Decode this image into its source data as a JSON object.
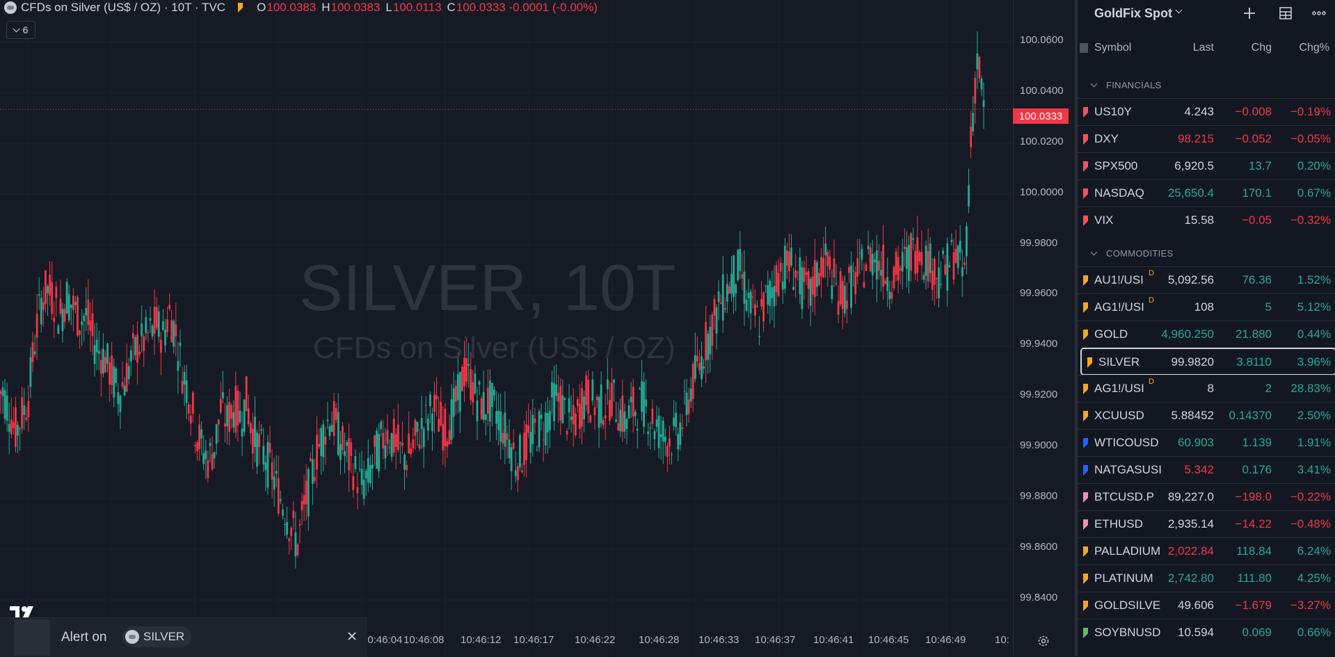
{
  "header": {
    "title": "CFDs on Silver (US$ / OZ) · 10T · TVC",
    "o_label": "O",
    "o_value": "100.0383",
    "h_label": "H",
    "h_value": "100.0383",
    "l_label": "L",
    "l_value": "100.0113",
    "c_label": "C",
    "c_value": "100.0333 -0.0001 (-0.00%)",
    "indicator_count": "6"
  },
  "watermark": {
    "line1": "SILVER, 10T",
    "line2": "CFDs on Silver (US$ / OZ)"
  },
  "price_scale": {
    "ticks": [
      "100.0600",
      "100.0400",
      "100.0200",
      "100.0000",
      "99.9800",
      "99.9600",
      "99.9400",
      "99.9200",
      "99.9000",
      "99.8800",
      "99.8600",
      "99.8400"
    ],
    "last_price": "100.0333"
  },
  "time_axis": {
    "ticks": [
      "10:46:04",
      "10:46:08",
      "10:46:12",
      "10:46:17",
      "10:46:22",
      "10:46:28",
      "10:46:33",
      "10:46:37",
      "10:46:41",
      "10:46:45",
      "10:46:49",
      "10:"
    ]
  },
  "chart_data": {
    "type": "candlestick",
    "symbol": "SILVER",
    "interval": "10T",
    "ylim": [
      99.83,
      100.07
    ],
    "last": 100.0333,
    "colors": {
      "up": "#22ab94",
      "down": "#f23645"
    },
    "closes": [
      99.922,
      99.915,
      99.906,
      99.912,
      99.92,
      99.942,
      99.958,
      99.962,
      99.958,
      99.952,
      99.96,
      99.955,
      99.95,
      99.952,
      99.943,
      99.938,
      99.935,
      99.928,
      99.922,
      99.926,
      99.934,
      99.94,
      99.942,
      99.945,
      99.948,
      99.944,
      99.953,
      99.945,
      99.93,
      99.922,
      99.908,
      99.9,
      99.895,
      99.9,
      99.915,
      99.91,
      99.916,
      99.912,
      99.918,
      99.906,
      99.9,
      99.896,
      99.89,
      99.882,
      99.876,
      99.868,
      99.862,
      99.876,
      99.886,
      99.898,
      99.906,
      99.912,
      99.908,
      99.9,
      99.895,
      99.89,
      99.885,
      99.888,
      99.896,
      99.902,
      99.906,
      99.902,
      99.898,
      99.896,
      99.9,
      99.906,
      99.91,
      99.916,
      99.911,
      99.906,
      99.912,
      99.92,
      99.93,
      99.926,
      99.92,
      99.916,
      99.918,
      99.914,
      99.908,
      99.903,
      99.895,
      99.897,
      99.902,
      99.906,
      99.908,
      99.912,
      99.92,
      99.918,
      99.912,
      99.908,
      99.915,
      99.92,
      99.918,
      99.916,
      99.917,
      99.92,
      99.915,
      99.91,
      99.914,
      99.916,
      99.918,
      99.912,
      99.908,
      99.905,
      99.903,
      99.905,
      99.91,
      99.92,
      99.928,
      99.935,
      99.944,
      99.95,
      99.958,
      99.962,
      99.968,
      99.97,
      99.96,
      99.952,
      99.95,
      99.958,
      99.962,
      99.968,
      99.972,
      99.972,
      99.968,
      99.962,
      99.96,
      99.968,
      99.974,
      99.97,
      99.962,
      99.96,
      99.963,
      99.966,
      99.97,
      99.974,
      99.976,
      99.972,
      99.968,
      99.967,
      99.97,
      99.974,
      99.977,
      99.978,
      99.975,
      99.971,
      99.968,
      99.97,
      99.975,
      99.975,
      99.968,
      100.02,
      100.055,
      100.0333
    ],
    "highs_note": "wick ranges estimated from picture"
  },
  "alert": {
    "prefix": "Alert on",
    "symbol": "SILVER"
  },
  "watchlist": {
    "title": "GoldFix Spot",
    "columns": {
      "symbol": "Symbol",
      "last": "Last",
      "chg": "Chg",
      "chgp": "Chg%"
    },
    "sections": [
      {
        "name": "FINANCIALS",
        "rows": [
          {
            "sym": "US10Y",
            "last": "4.243",
            "chg": "−0.008",
            "pct": "−0.19%",
            "flag": "#f7525f",
            "lastc": "wht",
            "chgc": "neg"
          },
          {
            "sym": "DXY",
            "last": "98.215",
            "chg": "−0.052",
            "pct": "−0.05%",
            "flag": "#f7525f",
            "lastc": "neg",
            "chgc": "neg"
          },
          {
            "sym": "SPX500",
            "last": "6,920.5",
            "chg": "13.7",
            "pct": "0.20%",
            "flag": "#f7525f",
            "lastc": "wht",
            "chgc": "pos"
          },
          {
            "sym": "NASDAQ",
            "last": "25,650.4",
            "chg": "170.1",
            "pct": "0.67%",
            "flag": "#f7525f",
            "lastc": "pos",
            "chgc": "pos"
          },
          {
            "sym": "VIX",
            "last": "15.58",
            "chg": "−0.05",
            "pct": "−0.32%",
            "flag": "#f7525f",
            "lastc": "wht",
            "chgc": "neg"
          }
        ]
      },
      {
        "name": "COMMODITIES",
        "rows": [
          {
            "sym": "AU1!/USI",
            "d": "D",
            "last": "5,092.56",
            "chg": "76.36",
            "pct": "1.52%",
            "flag": "#f6a821",
            "lastc": "wht",
            "chgc": "pos"
          },
          {
            "sym": "AG1!/USI",
            "d": "D",
            "last": "108",
            "chg": "5",
            "pct": "5.12%",
            "flag": "#f6a821",
            "lastc": "wht",
            "chgc": "pos"
          },
          {
            "sym": "GOLD",
            "last": "4,960.250",
            "chg": "21.880",
            "pct": "0.44%",
            "flag": "#f6a821",
            "lastc": "pos",
            "chgc": "pos"
          },
          {
            "sym": "SILVER",
            "last": "99.9820",
            "chg": "3.8110",
            "pct": "3.96%",
            "flag": "#f6a821",
            "lastc": "wht",
            "chgc": "pos",
            "selected": true
          },
          {
            "sym": "AG1!/USI",
            "d": "D",
            "last": "8",
            "chg": "2",
            "pct": "28.83%",
            "flag": "#f6a821",
            "lastc": "wht",
            "chgc": "pos"
          },
          {
            "sym": "XCUUSD",
            "last": "5.88452",
            "chg": "0.14370",
            "pct": "2.50%",
            "flag": "#f6a821",
            "lastc": "wht",
            "chgc": "pos"
          },
          {
            "sym": "WTICOUSD",
            "last": "60.903",
            "chg": "1.139",
            "pct": "1.91%",
            "flag": "#2962ff",
            "lastc": "pos",
            "chgc": "pos"
          },
          {
            "sym": "NATGASUSI",
            "last": "5.342",
            "chg": "0.176",
            "pct": "3.41%",
            "flag": "#2962ff",
            "lastc": "neg",
            "chgc": "pos"
          },
          {
            "sym": "BTCUSD.P",
            "last": "89,227.0",
            "chg": "−198.0",
            "pct": "−0.22%",
            "flag": "#f48fb1",
            "lastc": "wht",
            "chgc": "neg"
          },
          {
            "sym": "ETHUSD",
            "last": "2,935.14",
            "chg": "−14.22",
            "pct": "−0.48%",
            "flag": "#f48fb1",
            "lastc": "wht",
            "chgc": "neg"
          },
          {
            "sym": "PALLADIUM",
            "last": "2,022.84",
            "chg": "118.84",
            "pct": "6.24%",
            "flag": "#f6a821",
            "lastc": "neg",
            "chgc": "pos"
          },
          {
            "sym": "PLATINUM",
            "last": "2,742.80",
            "chg": "111.80",
            "pct": "4.25%",
            "flag": "#f6a821",
            "lastc": "pos",
            "chgc": "pos"
          },
          {
            "sym": "GOLDSILVE",
            "last": "49.606",
            "chg": "−1.679",
            "pct": "−3.27%",
            "flag": "#f6a821",
            "lastc": "wht",
            "chgc": "neg"
          },
          {
            "sym": "SOYBNUSD",
            "last": "10.594",
            "chg": "0.069",
            "pct": "0.66%",
            "flag": "#66bb6a",
            "lastc": "wht",
            "chgc": "pos"
          }
        ]
      }
    ]
  }
}
